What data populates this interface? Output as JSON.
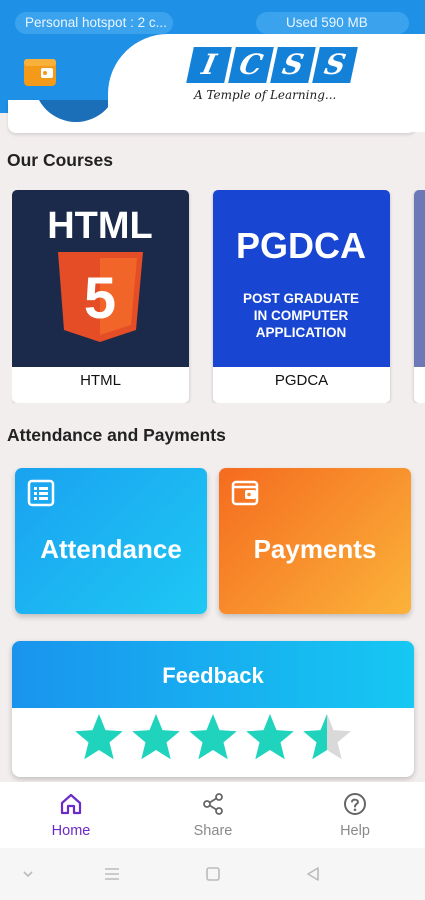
{
  "status_bar": {
    "hotspot_text": "Personal hotspot : 2 c...",
    "data_used_text": "Used  590 MB"
  },
  "header": {
    "logo_letters": [
      "I",
      "C",
      "S",
      "S"
    ],
    "tagline": "A Temple of Learning...",
    "wallet_icon": "wallet-icon",
    "brand_color": "#1e90e6"
  },
  "courses": {
    "title": "Our Courses",
    "items": [
      {
        "name": "HTML",
        "thumb_text": "HTML",
        "badge": "5",
        "thumb_color": "#1b2a4a"
      },
      {
        "name": "PGDCA",
        "thumb_text": "PGDCA",
        "thumb_subtext": [
          "POST GRADUATE",
          "IN COMPUTER",
          "APPLICATION"
        ],
        "thumb_color": "#1846d3"
      }
    ]
  },
  "attendance_payments": {
    "title": "Attendance and Payments",
    "attendance_label": "Attendance",
    "attendance_icon": "list-icon",
    "payments_label": "Payments",
    "payments_icon": "wallet-icon"
  },
  "feedback": {
    "title": "Feedback",
    "rating": 4.5,
    "max_rating": 5,
    "star_color": "#1fd3bd"
  },
  "bottom_nav": {
    "items": [
      {
        "label": "Home",
        "icon": "home-icon",
        "active": true
      },
      {
        "label": "Share",
        "icon": "share-icon",
        "active": false
      },
      {
        "label": "Help",
        "icon": "help-icon",
        "active": false
      }
    ],
    "active_color": "#6b2bc9"
  },
  "system_nav": [
    "chevron-down-icon",
    "menu-icon",
    "square-icon",
    "back-triangle-icon"
  ]
}
